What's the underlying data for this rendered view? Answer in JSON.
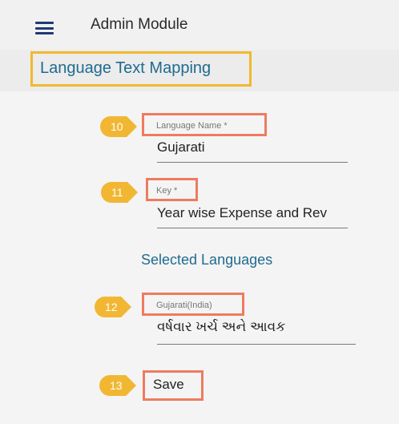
{
  "header": {
    "menu_icon": "hamburger-menu-icon",
    "title": "Admin Module"
  },
  "page": {
    "title": "Language Text Mapping"
  },
  "form": {
    "language_name": {
      "marker": "10",
      "label": "Language Name *",
      "value": "Gujarati"
    },
    "key": {
      "marker": "11",
      "label": "Key *",
      "value": "Year wise Expense and Rev"
    },
    "selected_languages_heading": "Selected Languages",
    "gujarati": {
      "marker": "12",
      "label": "Gujarati(India)",
      "value": "વર્ષવાર ખર્ચ અને આવક"
    },
    "save": {
      "marker": "13",
      "label": "Save"
    }
  },
  "colors": {
    "accent_title": "#1f6b8f",
    "highlight_yellow": "#f0b92e",
    "highlight_orange": "#ee7b5f",
    "marker": "#f1b733"
  }
}
